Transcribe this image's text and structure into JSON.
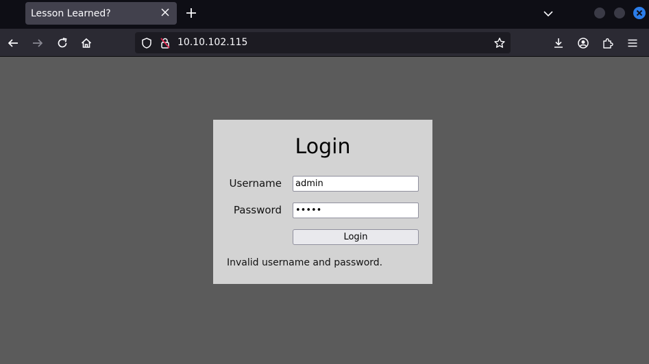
{
  "browser": {
    "tab_title": "Lesson Learned?",
    "url": "10.10.102.115"
  },
  "login": {
    "title": "Login",
    "username_label": "Username",
    "username_value": "admin",
    "password_label": "Password",
    "password_value": "admin",
    "button_label": "Login",
    "error_message": "Invalid username and password."
  },
  "colors": {
    "page_background": "#5b5b5b",
    "box_background": "#d3d3d3",
    "tabbar": "#0e0e15",
    "toolbar": "#2b2a33",
    "accent": "#2b7de9"
  }
}
